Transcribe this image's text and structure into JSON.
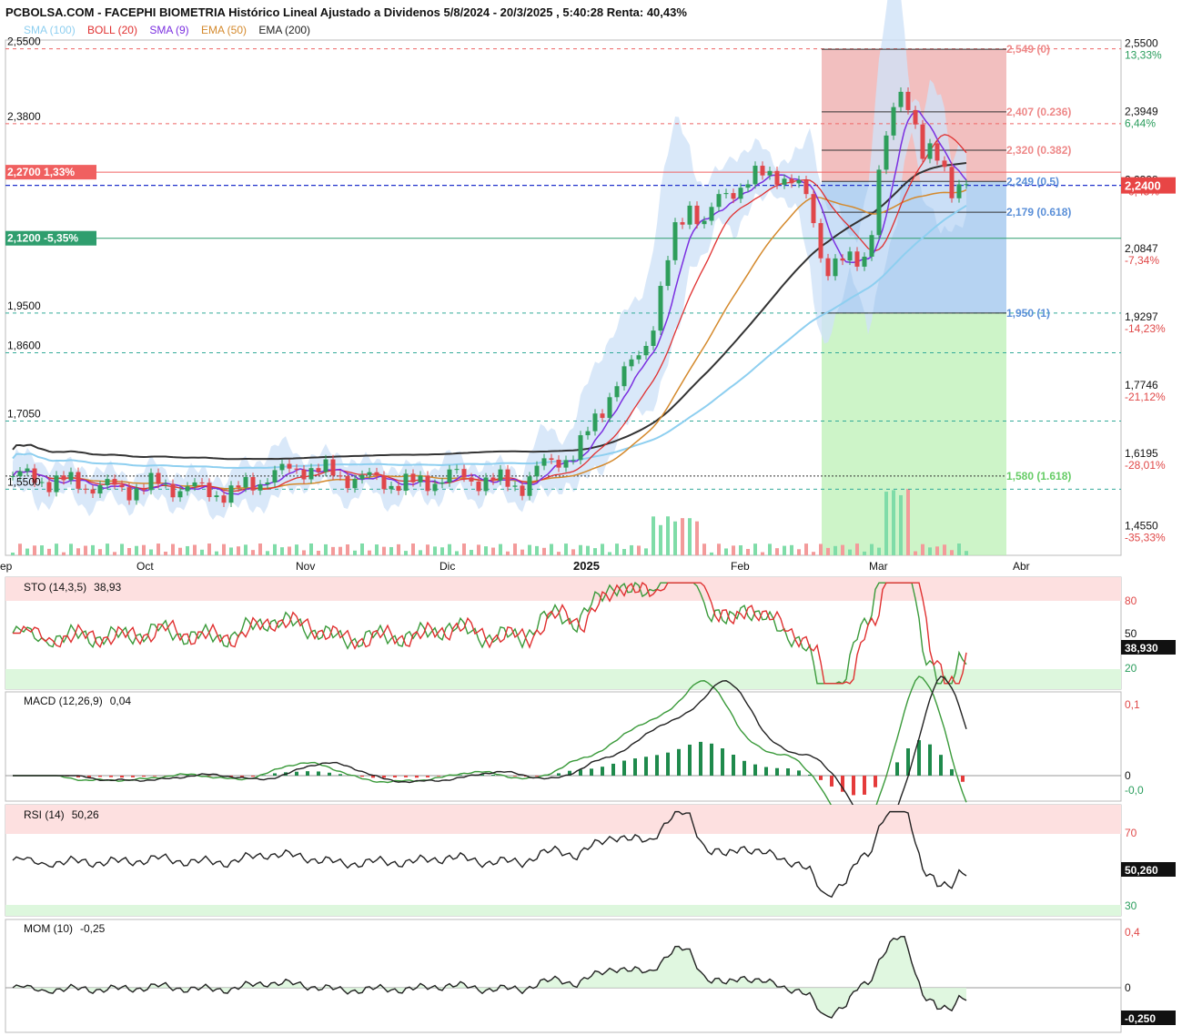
{
  "title": "PCBOLSA.COM - FACEPHI BIOMETRIA Histórico Lineal Ajustado a Dividenos 5/8/2024 - 20/3/2025 , 5:40:28 Renta: 40,43%",
  "colors": {
    "up": "#2e9e5b",
    "down": "#e0464a",
    "sma100": "#8ecff0",
    "boll": "#e03030",
    "sma9": "#7b2fe0",
    "ema50": "#d4892c",
    "ema200": "#333333",
    "band": "#cfe2f8"
  },
  "legend": [
    {
      "label": "SMA (100)",
      "color": "#8ecff0"
    },
    {
      "label": "BOLL (20)",
      "color": "#e03030"
    },
    {
      "label": "SMA (9)",
      "color": "#7b2fe0"
    },
    {
      "label": "EMA (50)",
      "color": "#d4892c"
    },
    {
      "label": "EMA (200)",
      "color": "#222222"
    }
  ],
  "chart_data": {
    "type": "candlestick",
    "y_range": [
      1.4,
      2.57
    ],
    "left_ticks": [
      "2,5500",
      "2,3800",
      "1,9500",
      "1,8600",
      "1,7050",
      "1,5500"
    ],
    "right_ticks": [
      {
        "value": "2,5500",
        "pct": "13,33%"
      },
      {
        "value": "2,3949",
        "pct": "6,44%"
      },
      {
        "value": "2,2398",
        "pct": "-0,45%"
      },
      {
        "value": "2,0847",
        "pct": "-7,34%"
      },
      {
        "value": "1,9297",
        "pct": "-14,23%"
      },
      {
        "value": "1,7746",
        "pct": "-21,12%"
      },
      {
        "value": "1,6195",
        "pct": "-28,01%"
      },
      {
        "value": "1,4550",
        "pct": "-35,33%"
      }
    ],
    "x_labels": [
      "ep",
      "Oct",
      "Nov",
      "Dic",
      "2025",
      "Feb",
      "Mar",
      "Abr"
    ],
    "price_badges": [
      {
        "value": "2,2700",
        "pct": "1,33%",
        "color": "#f06060"
      },
      {
        "value": "2,1200",
        "pct": "-5,35%",
        "color": "#2f9e6e"
      },
      {
        "value": "2,2400",
        "color": "#e84545"
      }
    ],
    "fib_levels": [
      {
        "label": "2,549 (0)",
        "value": 2.549
      },
      {
        "label": "2,407 (0.236)",
        "value": 2.407
      },
      {
        "label": "2,320 (0.382)",
        "value": 2.32
      },
      {
        "label": "2,249 (0.5)",
        "value": 2.249
      },
      {
        "label": "2,179 (0.618)",
        "value": 2.179
      },
      {
        "label": "1,950 (1)",
        "value": 1.95
      },
      {
        "label": "1,580 (1.618)",
        "value": 1.58
      }
    ],
    "keypoints": [
      [
        0,
        1.58
      ],
      [
        10,
        1.57
      ],
      [
        20,
        1.56
      ],
      [
        30,
        1.55
      ],
      [
        40,
        1.56
      ],
      [
        50,
        1.55
      ],
      [
        60,
        1.54
      ],
      [
        70,
        1.58
      ],
      [
        80,
        1.6
      ],
      [
        90,
        1.58
      ],
      [
        100,
        1.57
      ],
      [
        110,
        1.56
      ],
      [
        120,
        1.58
      ],
      [
        130,
        1.57
      ],
      [
        140,
        1.56
      ],
      [
        145,
        1.6
      ],
      [
        150,
        1.62
      ],
      [
        155,
        1.63
      ],
      [
        160,
        1.71
      ],
      [
        165,
        1.78
      ],
      [
        170,
        1.83
      ],
      [
        175,
        1.9
      ],
      [
        178,
        2.0
      ],
      [
        182,
        2.13
      ],
      [
        186,
        2.2
      ],
      [
        190,
        2.15
      ],
      [
        195,
        2.22
      ],
      [
        200,
        2.24
      ],
      [
        205,
        2.26
      ],
      [
        210,
        2.27
      ],
      [
        215,
        2.24
      ],
      [
        219,
        2.2
      ],
      [
        223,
        2.05
      ],
      [
        227,
        2.06
      ],
      [
        231,
        2.07
      ],
      [
        235,
        2.09
      ],
      [
        238,
        2.26
      ],
      [
        241,
        2.38
      ],
      [
        244,
        2.46
      ],
      [
        247,
        2.42
      ],
      [
        250,
        2.3
      ],
      [
        253,
        2.31
      ],
      [
        256,
        2.28
      ],
      [
        258,
        2.24
      ],
      [
        262,
        2.24
      ]
    ],
    "sto": {
      "label": "STO (14,3,5)",
      "value": "38,93",
      "badge": "38,930",
      "ticks": [
        "80",
        "50",
        "20"
      ]
    },
    "macd": {
      "label": "MACD (12,26,9)",
      "value": "0,04",
      "ticks": [
        "0,1",
        "0",
        "-0,0"
      ]
    },
    "rsi": {
      "label": "RSI (14)",
      "value": "50,26",
      "badge": "50,260",
      "ticks": [
        "70",
        "30"
      ]
    },
    "mom": {
      "label": "MOM (10)",
      "value": "-0,25",
      "badge": "-0,250",
      "ticks": [
        "0,4",
        "0"
      ]
    }
  }
}
